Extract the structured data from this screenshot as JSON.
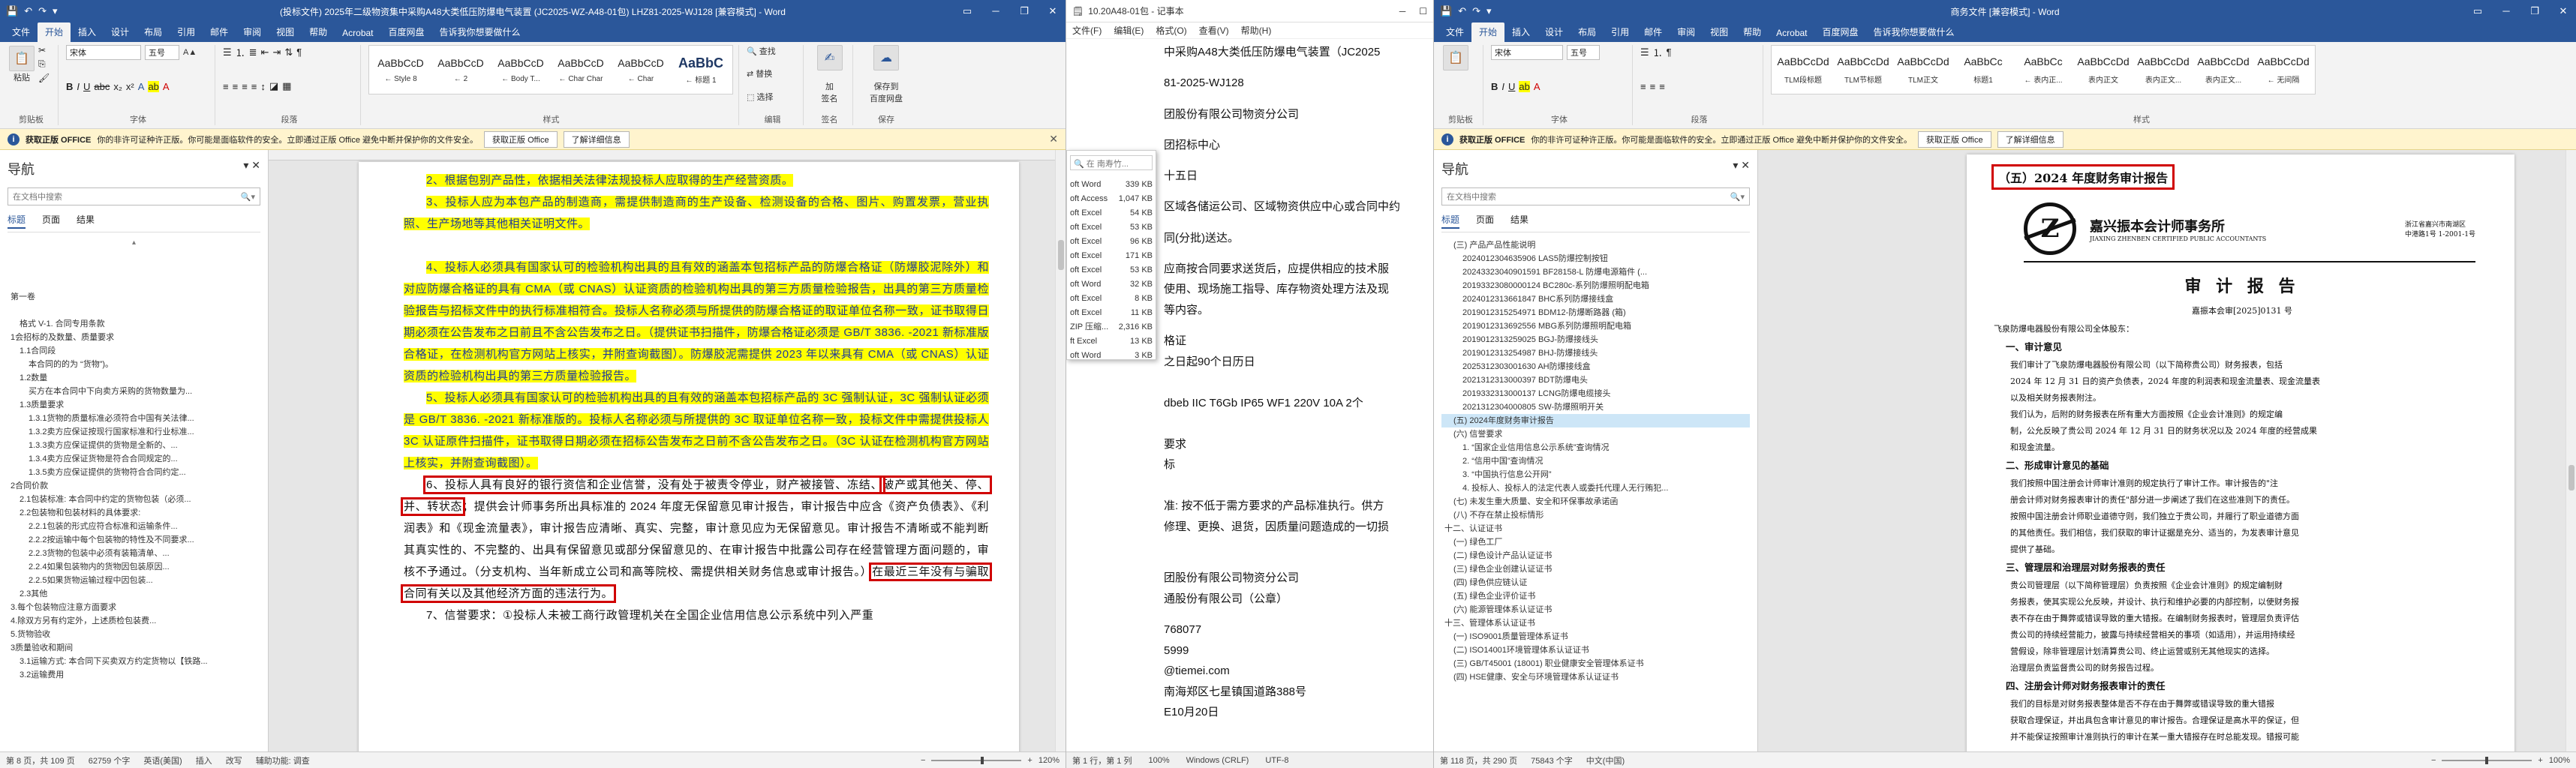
{
  "left": {
    "titlebar": {
      "qat": [
        "💾",
        "↶",
        "↷",
        "▾"
      ],
      "title": "(投标文件) 2025年二级物资集中采购A48大类低压防爆电气装置 (JC2025-WZ-A48-01包) LHZ81-2025-WJ128 [兼容模式] - Word"
    },
    "tabs": [
      "文件",
      "开始",
      "插入",
      "设计",
      "布局",
      "引用",
      "邮件",
      "审阅",
      "视图",
      "帮助",
      "Acrobat",
      "百度网盘",
      "告诉我你想要做什么"
    ],
    "active_tab": "开始",
    "ribbon": {
      "clipboard_label": "剪贴板",
      "paste": "粘贴",
      "font_name": "宋体",
      "font_size": "五号",
      "font_label": "字体",
      "para_label": "段落",
      "styles_label": "样式",
      "styles": [
        {
          "preview": "AaBbCcD",
          "name": "← Style 8"
        },
        {
          "preview": "AaBbCcD",
          "name": "← 2"
        },
        {
          "preview": "AaBbCcD",
          "name": "← Body T..."
        },
        {
          "preview": "AaBbCcD",
          "name": "← Char Char"
        },
        {
          "preview": "AaBbCcD",
          "name": "← Char"
        },
        {
          "preview": "AaBbC",
          "name": "← 标题 1"
        }
      ],
      "edit_label": "编辑",
      "find": "查找",
      "replace": "替换",
      "select": "选择",
      "sign": "加\n签名",
      "sign_label": "签名",
      "save_baidu": "保存到\n百度网盘",
      "save_label": "保存"
    },
    "message": {
      "title": "获取正版 OFFICE",
      "text": "你的非许可证种许正版。你可能是面临软件的安全。立即通过正版 Office 避免中断并保护你的文件安全。",
      "btn1": "获取正版 Office",
      "btn2": "了解详细信息"
    },
    "nav": {
      "title": "导航",
      "search_placeholder": "在文档中搜索",
      "tabs": [
        "标题",
        "页面",
        "结果"
      ],
      "items": [
        {
          "t": "第一卷",
          "lv": "lv1"
        },
        {
          "t": "",
          "lv": "lv1"
        },
        {
          "t": "格式 V-1. 合同专用条款",
          "lv": "lv2"
        },
        {
          "t": "1会招标的及数量、质量要求",
          "lv": "lv1"
        },
        {
          "t": "1.1合同段",
          "lv": "lv2"
        },
        {
          "t": "本合同的的为 “货物”)。",
          "lv": "lv3"
        },
        {
          "t": "1.2数量",
          "lv": "lv2"
        },
        {
          "t": "买方在本合同中下向卖方采购的货物数量为...",
          "lv": "lv3"
        },
        {
          "t": "1.3质量要求",
          "lv": "lv2"
        },
        {
          "t": "1.3.1货物的质量标准必须符合中国有关法律...",
          "lv": "lv3"
        },
        {
          "t": "1.3.2卖方应保证按现行国家标准和行业标准...",
          "lv": "lv3"
        },
        {
          "t": "1.3.3卖方应保证提供的货物是全新的、...",
          "lv": "lv3"
        },
        {
          "t": "1.3.4卖方应保证货物是符合合同规定的...",
          "lv": "lv3"
        },
        {
          "t": "1.3.5卖方应保证提供的货物符合合同约定...",
          "lv": "lv3"
        },
        {
          "t": "2合同价款",
          "lv": "lv1"
        },
        {
          "t": "2.1包装标准: 本合同中约定的货物包装（必须...",
          "lv": "lv2"
        },
        {
          "t": "2.2包装物和包装材料的具体要求:",
          "lv": "lv2"
        },
        {
          "t": "2.2.1包装的形式应符合标准和运输条件...",
          "lv": "lv3"
        },
        {
          "t": "2.2.2按运输中每个包装物的特性及不同要求...",
          "lv": "lv3"
        },
        {
          "t": "2.2.3货物的包装中必须有装箱清单、...",
          "lv": "lv3"
        },
        {
          "t": "2.2.4如果包装物内的货物因包装原因...",
          "lv": "lv3"
        },
        {
          "t": "2.2.5如果货物运输过程中因包装...",
          "lv": "lv3"
        },
        {
          "t": "2.3其他",
          "lv": "lv2"
        },
        {
          "t": "3.每个包装物应注意方面要求",
          "lv": "lv1"
        },
        {
          "t": "4.除双方另有约定外，上述质检包装费...",
          "lv": "lv1"
        },
        {
          "t": "5.货物验收",
          "lv": "lv1"
        },
        {
          "t": "3质量验收和期间",
          "lv": "lv1"
        },
        {
          "t": "3.1运输方式: 本合同下买卖双方约定货物以【铁路...",
          "lv": "lv2"
        },
        {
          "t": "3.2运输费用",
          "lv": "lv2"
        }
      ]
    },
    "doc": {
      "paras": [
        {
          "text": "2、根据包别产品性，依据相关法律法规投标人应取得的生产经营资质。",
          "hl": true
        },
        {
          "text": "3、投标人应为本包产品的制造商，需提供制造商的生产设备、检测设备的合格、图片、购置发票，营业执照、生产场地等其他相关证明文件。",
          "hl": true
        },
        {
          "text": "",
          "hl": false
        },
        {
          "text": "4、投标人必须具有国家认可的检验机构出具的且有效的涵盖本包招标产品的防爆合格证（防爆胶泥除外）和对应防爆合格证的具有 CMA（或 CNAS）认证资质的检验机构出具的第三方质量检验报告，出具的第三方质量检验报告与招标文件中的执行标准相符合。投标人名称必须与所提供的防爆合格证的取证单位名称一致，证书取得日期必须在公告发布之日前且不含公告发布之日。（提供证书扫描件，防爆合格证必须是 GB/T 3836. -2021 新标准版合格证，在检测机构官方网站上核实，并附查询截图）。防爆胶泥需提供 2023 年以来具有 CMA（或 CNAS）认证资质的检验机构出具的第三方质量检验报告。",
          "hl": true
        },
        {
          "text": "5、投标人必须具有国家认可的检验机构出具的且有效的涵盖本包招标产品的 3C 强制认证，3C 强制认证必须是 GB/T 3836. -2021 新标准版的。投标人名称必须与所提供的 3C 取证单位名称一致，投标文件中需提供投标人 3C 认证原件扫描件，证书取得日期必须在招标公告发布之日前不含公告发布之日。（3C 认证在检测机构官方网站上核实，并附查询截图）。",
          "hl": true
        }
      ],
      "para6_a": "6、投标人具有良好的银行资信和企业信誉，没有处于被责令停业，财产被接管、冻结、",
      "para6_b": "破产或其他关、停、并、转状态",
      "para6_c": "；提供会计师事务所出具标准的 2024 年度无保留意见审计报告，审计报告中应含《资产负债表》、《利润表》和《现金流量表》，审计报告应清晰、真实、完整，审计意见应为无保留意见。审计报告不清晰或不能判断其真实性的、不完整的、出具有保留意见或部分保留意见的、在审计报告中批露公司存在经营管理方面问题的，审核不予通过。（分支机构、当年新成立公司和高等院校、需提供相关财务信息或审计报告。）",
      "para6_d": "在最近三年没有与骗取合同有关以及其他经济方面的违法行为。",
      "para7": "7、信誉要求：①投标人未被工商行政管理机关在全国企业信用信息公示系统中列入严重"
    },
    "status": {
      "page": "第 8 页，共 109 页",
      "words": "62759 个字",
      "lang": "英语(美国)",
      "insert": "插入",
      "cmode": "改写",
      "access": "辅助功能: 调查",
      "zoom": "120%"
    }
  },
  "mid": {
    "title": "10.20A48-01包 - 记事本",
    "menu": [
      "文件(F)",
      "编辑(E)",
      "格式(O)",
      "查看(V)",
      "帮助(H)"
    ],
    "lines": [
      "中采购A48大类低压防爆电气装置（JC2025",
      "",
      "81-2025-WJ128",
      "",
      "团股份有限公司物资分公司",
      "",
      "团招标中心",
      "",
      "十五日",
      "",
      "区域各储运公司、区域物资供应中心或合同中约",
      "",
      "同(分批)送达。",
      "",
      "应商按合同要求送货后，应提供相应的技术服",
      "使用、现场施工指导、库存物资处理方法及现",
      "等内容。",
      "",
      "格证",
      "之日起90个日历日",
      "",
      "",
      "dbeb IIC T6Gb IP65 WF1 220V 10A 2个",
      "",
      "",
      "要求",
      "标",
      "",
      "",
      "准: 按不低于需方要求的产品标准执行。供方",
      "修理、更换、退货，因质量问题造成的一切损",
      "",
      "",
      "",
      "团股份有限公司物资分公司",
      "通股份有限公司（公章）",
      "",
      "768077",
      "5999",
      "@tiemei.com",
      "南海郑区七星镇国道路388号",
      "E10月20日"
    ],
    "explorer": {
      "search": "在 南寿竹...",
      "rows": [
        {
          "name": "oft Word",
          "size": "339 KB"
        },
        {
          "name": "oft Access",
          "size": "1,047 KB"
        },
        {
          "name": "oft Excel",
          "size": "54 KB"
        },
        {
          "name": "oft Excel",
          "size": "53 KB"
        },
        {
          "name": "oft Excel",
          "size": "96 KB"
        },
        {
          "name": "oft Excel",
          "size": "171 KB"
        },
        {
          "name": "oft Excel",
          "size": "53 KB"
        },
        {
          "name": "oft Word",
          "size": "32 KB"
        },
        {
          "name": "oft Excel",
          "size": "8 KB"
        },
        {
          "name": "oft Excel",
          "size": "11 KB"
        },
        {
          "name": "ZIP 压缩...",
          "size": "2,316 KB"
        },
        {
          "name": "ft Excel",
          "size": "13 KB"
        },
        {
          "name": "oft Word",
          "size": "3 KB"
        }
      ]
    },
    "status": {
      "line": "第 1 行，第 1 列",
      "zoom": "100%",
      "eol": "Windows (CRLF)",
      "enc": "UTF-8"
    }
  },
  "right": {
    "titlebar": {
      "qat": [
        "💾",
        "↶",
        "↷",
        "▾"
      ],
      "title": "商务文件 [兼容模式] - Word"
    },
    "tabs": [
      "文件",
      "开始",
      "插入",
      "设计",
      "布局",
      "引用",
      "邮件",
      "审阅",
      "视图",
      "帮助",
      "Acrobat",
      "百度网盘",
      "告诉我你想要做什么"
    ],
    "active_tab": "开始",
    "ribbon": {
      "font_name": "宋体",
      "font_size": "五号",
      "styles": [
        {
          "preview": "AaBbCcDd",
          "name": "TLM段标题"
        },
        {
          "preview": "AaBbCcDd",
          "name": "TLM节标题"
        },
        {
          "preview": "AaBbCcDd",
          "name": "TLM正文"
        },
        {
          "preview": "AaBbCc",
          "name": "标题1"
        },
        {
          "preview": "AaBbCc",
          "name": "← 表内正..."
        },
        {
          "preview": "AaBbCcDd",
          "name": "表内正文"
        },
        {
          "preview": "AaBbCcDd",
          "name": "表内正文..."
        },
        {
          "preview": "AaBbCcDd",
          "name": "表内正文..."
        },
        {
          "preview": "AaBbCcDd",
          "name": "← 无间隔"
        }
      ]
    },
    "message": {
      "title": "获取正版 OFFICE",
      "text": "你的非许可证种许正版。你可能是面临软件的安全。立即通过正版 Office 避免中断并保护你的文件安全。",
      "btn1": "获取正版 Office",
      "btn2": "了解详细信息"
    },
    "nav": {
      "title": "导航",
      "search_placeholder": "在文档中搜索",
      "tabs": [
        "标题",
        "页面",
        "结果"
      ],
      "items": [
        {
          "t": "(三) 产品产品性能说明",
          "lv": "lv2"
        },
        {
          "t": "20240123046​35906 LAS5防爆控制按钮",
          "lv": "lv3"
        },
        {
          "t": "20243323040901591 BF28158-L 防爆电源箱件 (...",
          "lv": "lv3"
        },
        {
          "t": "20193323080000124 BC280c-系列防爆照明配电箱",
          "lv": "lv3"
        },
        {
          "t": "2024012313661847 BHC系列防爆接线盒",
          "lv": "lv3"
        },
        {
          "t": "2019012315254971 BDM12-防爆断路器 (箱)",
          "lv": "lv3"
        },
        {
          "t": "2019012313692556 MBG系列防爆照明配电箱",
          "lv": "lv3"
        },
        {
          "t": "2019012313259025 BGJ-防爆接线头",
          "lv": "lv3"
        },
        {
          "t": "2019012313254987 BHJ-防爆接线头",
          "lv": "lv3"
        },
        {
          "t": "2025312303001630 AH防爆接线盒",
          "lv": "lv3"
        },
        {
          "t": "2021312313000397 BDT防爆电头",
          "lv": "lv3"
        },
        {
          "t": "2019332313000137 LCNG防爆电缆接头",
          "lv": "lv3"
        },
        {
          "t": "2021312304000805 SW-防爆照明开关",
          "lv": "lv3"
        },
        {
          "t": "(五) 2024年度财务审计报告",
          "lv": "lv2",
          "sel": true
        },
        {
          "t": "(六) 信誉要求",
          "lv": "lv2"
        },
        {
          "t": "1. “国家企业信用信息公示系统”查询情况",
          "lv": "lv3"
        },
        {
          "t": "2. “信用中国”查询情况",
          "lv": "lv3"
        },
        {
          "t": "3. “中国执行信息公开网”",
          "lv": "lv3"
        },
        {
          "t": "4. 投标人、投标人的法定代表人或委托代理人无行贿犯...",
          "lv": "lv3"
        },
        {
          "t": "(七) 未发生重大质量、安全和环保事故承诺函",
          "lv": "lv2"
        },
        {
          "t": "(八) 不存在禁止投标情形",
          "lv": "lv2"
        },
        {
          "t": "十二、认证证书",
          "lv": "lv1"
        },
        {
          "t": "(一) 绿色工厂",
          "lv": "lv2"
        },
        {
          "t": "(二) 绿色设计产品认证证书",
          "lv": "lv2"
        },
        {
          "t": "(三) 绿色企业创建认证证书",
          "lv": "lv2"
        },
        {
          "t": "(四) 绿色供应链认证",
          "lv": "lv2"
        },
        {
          "t": "(五) 绿色企业评价证书",
          "lv": "lv2"
        },
        {
          "t": "(六) 能源管理体系认证证书",
          "lv": "lv2"
        },
        {
          "t": "十三、管理体系认证证书",
          "lv": "lv1"
        },
        {
          "t": "(一) ISO9001质量管理体系证书",
          "lv": "lv2"
        },
        {
          "t": "(二) ISO14001环境管理体系认证证书",
          "lv": "lv2"
        },
        {
          "t": "(三) GB/T45001 (18001) 职业健康安全管理体系证书",
          "lv": "lv2"
        },
        {
          "t": "(四) HSE健康、安全与环境管理体系认证证书",
          "lv": "lv2"
        }
      ]
    },
    "doc": {
      "heading": "（五）2024 年度财务审计报告",
      "firm": {
        "name": "嘉兴振本会计师事务所",
        "en": "JIAXING ZHENBEN CERTIFIED PUBLIC ACCOUNTANTS",
        "addr": "浙江省嘉兴市南湖区\n中港路1号 1-2001-1号",
        "logo": "Z"
      },
      "report_title": "审 计 报 告",
      "report_no": "嘉振本会审[2025]0131 号",
      "salute": "飞泉防爆电器股份有限公司全体股东：",
      "sections": [
        {
          "h": "一、审计意见",
          "p": [
            "我们审计了飞泉防爆电器股份有限公司（以下简称贵公司）财务报表，包括",
            "2024 年 12 月 31 日的资产负债表，2024 年度的利润表和现金流量表、现金流量表",
            "以及相关财务报表附注。",
            "我们认为，后附的财务报表在所有重大方面按照《企业会计准则》的规定编",
            "制，公允反映了贵公司 2024 年 12 月 31 日的财务状况以及 2024 年度的经营成果",
            "和现金流量。"
          ]
        },
        {
          "h": "二、形成审计意见的基础",
          "p": [
            "我们按照中国注册会计师审计准则的规定执行了审计工作。审计报告的\"注",
            "册会计师对财务报表审计的责任\"部分进一步阐述了我们在这些准则下的责任。",
            "按照中国注册会计师职业道德守则，我们独立于贵公司，并履行了职业道德方面",
            "的其他责任。我们相信，我们获取的审计证据是充分、适当的，为发表审计意见",
            "提供了基础。"
          ]
        },
        {
          "h": "三、管理层和治理层对财务报表的责任",
          "p": [
            "贵公司管理层（以下简称管理层）负责按照《企业会计准则》的规定编制财",
            "务报表，使其实现公允反映，并设计、执行和维护必要的内部控制，以使财务报",
            "表不存在由于舞弊或错误导致的重大错报。在编制财务报表时，管理层负责评估",
            "贵公司的持续经营能力，披露与持续经营相关的事项（如适用），并运用持续经",
            "营假设，除非管理层计划清算贵公司、终止运营或别无其他现实的选择。",
            "治理层负责监督贵公司的财务报告过程。"
          ]
        },
        {
          "h": "四、注册会计师对财务报表审计的责任",
          "p": [
            "我们的目标是对财务报表整体是否不存在由于舞弊或错误导致的重大错报",
            "获取合理保证，并出具包含审计意见的审计报告。合理保证是高水平的保证，但",
            "并不能保证按照审计准则执行的审计在某一重大错报存在时总能发现。错报可能"
          ]
        }
      ]
    },
    "status": {
      "page": "第 118 页，共 290 页",
      "words": "75843 个字",
      "lang": "中文(中国)",
      "zoom": "100%"
    }
  },
  "colors": {
    "word_blue": "#2b579a",
    "highlight": "#ffff00",
    "annotation_red": "#d00000",
    "msgbar": "#fff4ce"
  }
}
